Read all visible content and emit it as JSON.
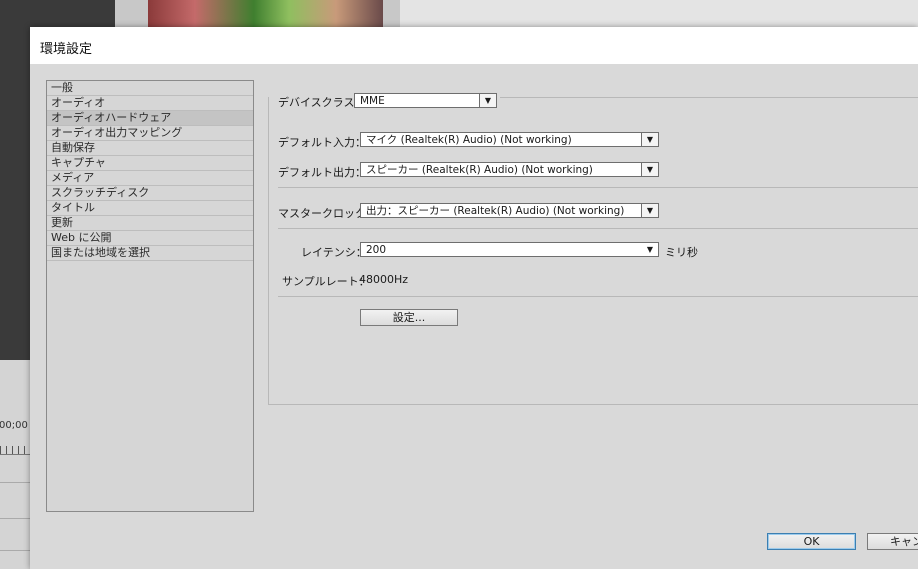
{
  "background": {
    "timecode": "00;00"
  },
  "dialog": {
    "title": "環境設定",
    "categories": [
      {
        "label": "一般"
      },
      {
        "label": "オーディオ"
      },
      {
        "label": "オーディオハードウェア",
        "selected": true
      },
      {
        "label": "オーディオ出力マッピング"
      },
      {
        "label": "自動保存"
      },
      {
        "label": "キャプチャ"
      },
      {
        "label": "メディア"
      },
      {
        "label": "スクラッチディスク"
      },
      {
        "label": "タイトル"
      },
      {
        "label": "更新"
      },
      {
        "label": "Web に公開"
      },
      {
        "label": "国または地域を選択"
      }
    ],
    "device_class": {
      "label": "デバイスクラス：",
      "value": "MME"
    },
    "default_input": {
      "label": "デフォルト入力：",
      "value": "マイク (Realtek(R) Audio) (Not working)"
    },
    "default_output": {
      "label": "デフォルト出力：",
      "value": "スピーカー (Realtek(R) Audio) (Not working)"
    },
    "master_clock": {
      "label": "マスタークロック：",
      "value": "出力：スピーカー (Realtek(R) Audio) (Not working)"
    },
    "latency": {
      "label": "レイテンシ：",
      "value": "200",
      "unit": "ミリ秒"
    },
    "sample_rate": {
      "label": "サンプルレート：",
      "value": "48000Hz"
    },
    "settings_button": "設定...",
    "ok_button": "OK",
    "cancel_button": "キャンセル"
  },
  "icons": {
    "dropdown": "chevron-down-icon"
  }
}
